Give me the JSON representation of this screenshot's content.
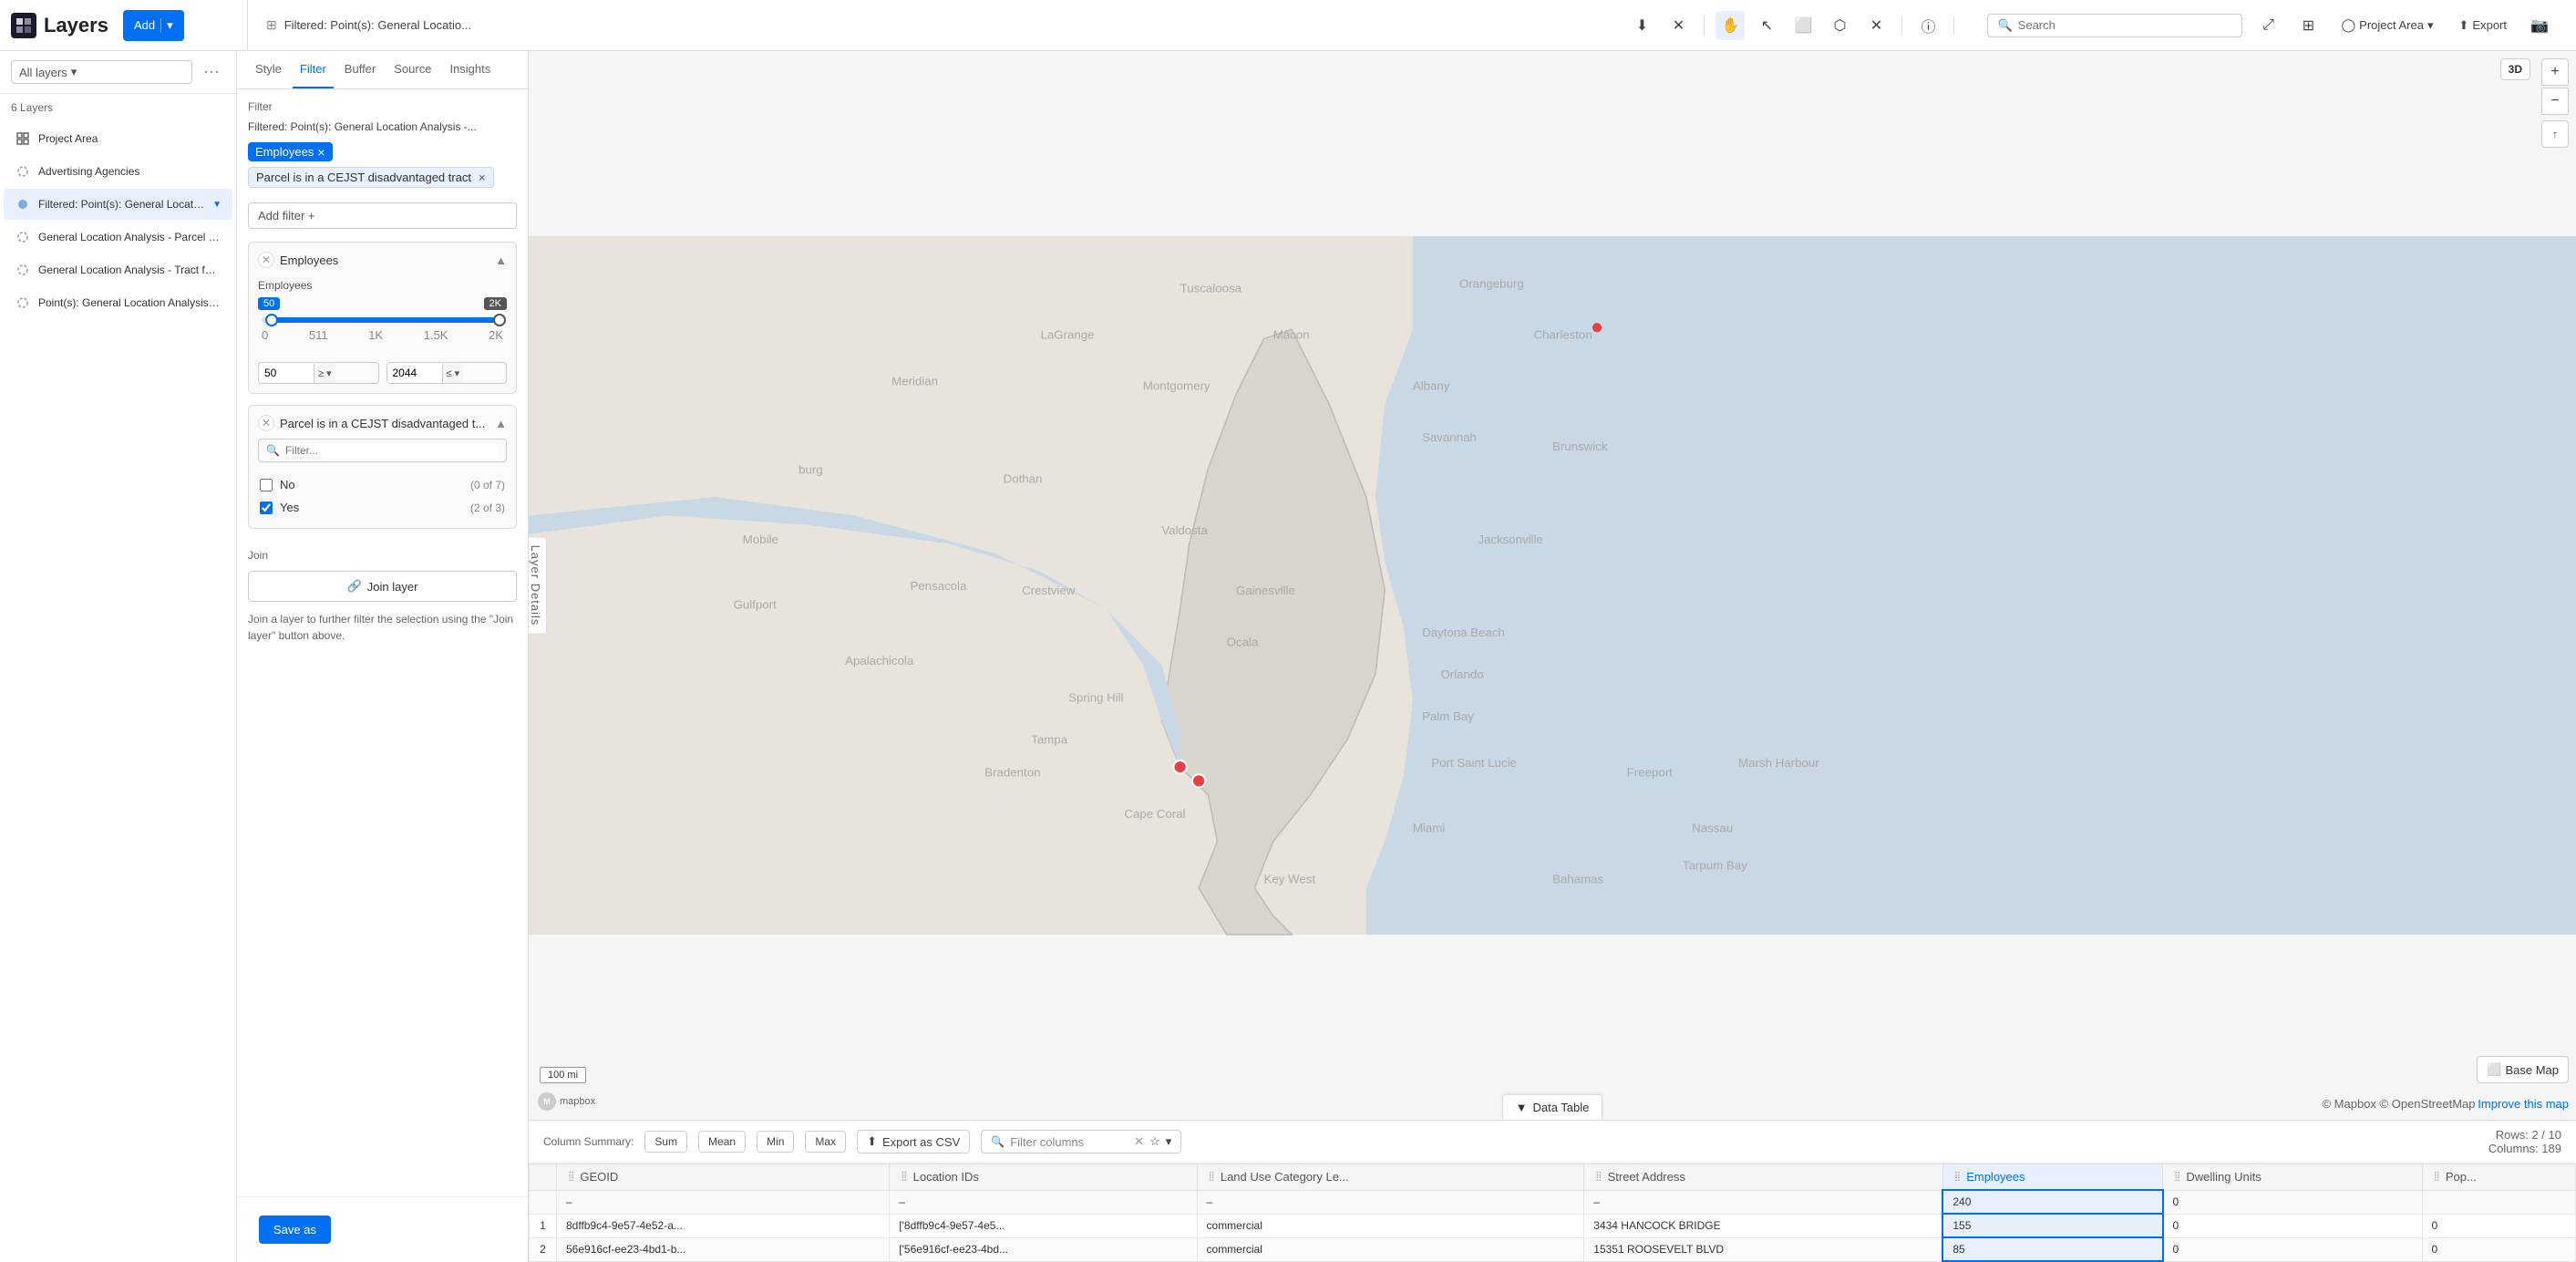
{
  "topbar": {
    "layers_title": "Layers",
    "add_btn": "Add",
    "filter_panel_title": "Filtered: Point(s): General Locatio...",
    "search_placeholder": "Search",
    "project_area": "Project Area",
    "export": "Export"
  },
  "sidebar": {
    "all_layers": "All layers",
    "layer_count": "6 Layers",
    "items": [
      {
        "name": "Project Area",
        "icon": "grid",
        "active": false,
        "filtered": false
      },
      {
        "name": "Advertising Agencies",
        "icon": "dot",
        "active": false,
        "filtered": false
      },
      {
        "name": "Filtered: Point(s): General Location A...",
        "icon": "dot",
        "active": true,
        "filtered": true
      },
      {
        "name": "General Location Analysis - Parcel for Adv...",
        "icon": "dot",
        "active": false,
        "filtered": false
      },
      {
        "name": "General Location Analysis - Tract for Adve...",
        "icon": "dot",
        "active": false,
        "filtered": false
      },
      {
        "name": "Point(s): General Location Analysis - Parce...",
        "icon": "dot",
        "active": false,
        "filtered": false
      }
    ]
  },
  "filter_panel": {
    "tabs": [
      "Style",
      "Filter",
      "Buffer",
      "Source",
      "Insights"
    ],
    "active_tab": "Filter",
    "breadcrumb": "Filtered: Point(s): General Location Analysis -...",
    "filter_label": "Filter",
    "active_tags": [
      {
        "label": "Employees",
        "removable": true
      },
      {
        "label": "Parcel is in a CEJST disadvantaged tract",
        "removable": true
      }
    ],
    "add_filter_btn": "Add filter  +",
    "employees_filter": {
      "title": "Employees",
      "range_min": 50,
      "range_max": 2044,
      "display_min": "50",
      "display_max": "2K",
      "tick_labels": [
        "0",
        "511",
        "1K",
        "1.5K",
        "2K"
      ],
      "input_min": "50",
      "input_max": "2044",
      "op_min": "≥",
      "op_max": "≤"
    },
    "cejst_filter": {
      "title": "Parcel is in a CEJST disadvantaged t...",
      "search_placeholder": "Filter...",
      "options": [
        {
          "label": "No",
          "count": "0 of 7",
          "checked": false
        },
        {
          "label": "Yes",
          "count": "2 of 3",
          "checked": true
        }
      ]
    },
    "join_section": {
      "label": "Join",
      "btn": "Join layer",
      "description": "Join a layer to further filter the selection using the \"Join layer\" button above."
    },
    "save_as_btn": "Save as"
  },
  "map": {
    "scale_label": "100 mi",
    "attribution": "© Mapbox © OpenStreetMap",
    "improve_text": "Improve this map",
    "base_map_btn": "Base Map",
    "layer_details_tab": "Layer Details",
    "data_table_btn": "Data Table",
    "zoom_in": "+",
    "zoom_out": "−",
    "compass": "↑"
  },
  "data_table": {
    "column_summary_label": "Column Summary:",
    "summary_btns": [
      "Sum",
      "Mean",
      "Min",
      "Max"
    ],
    "export_csv_btn": "Export as CSV",
    "filter_cols_placeholder": "Filter columns",
    "rows_info": "Rows: 2 / 10",
    "cols_info": "Columns: 189",
    "columns": [
      {
        "label": "GEOID",
        "highlighted": false
      },
      {
        "label": "Location IDs",
        "highlighted": false
      },
      {
        "label": "Land Use Category Le...",
        "highlighted": false
      },
      {
        "label": "Street Address",
        "highlighted": false
      },
      {
        "label": "Employees",
        "highlighted": true
      },
      {
        "label": "Dwelling Units",
        "highlighted": false
      },
      {
        "label": "Pop...",
        "highlighted": false
      }
    ],
    "totals": [
      "",
      "",
      "",
      "",
      "240",
      "0",
      ""
    ],
    "rows": [
      {
        "num": "1",
        "geoid": "8dffb9c4-9e57-4e52-a...",
        "location_ids": "['8dffb9c4-9e57-4e5...",
        "land_use": "commercial",
        "street_address": "3434 HANCOCK BRIDGE",
        "employees": "155",
        "dwelling_units": "0",
        "pop": "0"
      },
      {
        "num": "2",
        "geoid": "56e916cf-ee23-4bd1-b...",
        "location_ids": "['56e916cf-ee23-4bd...",
        "land_use": "commercial",
        "street_address": "15351 ROOSEVELT BLVD",
        "employees": "85",
        "dwelling_units": "0",
        "pop": "0"
      }
    ]
  }
}
